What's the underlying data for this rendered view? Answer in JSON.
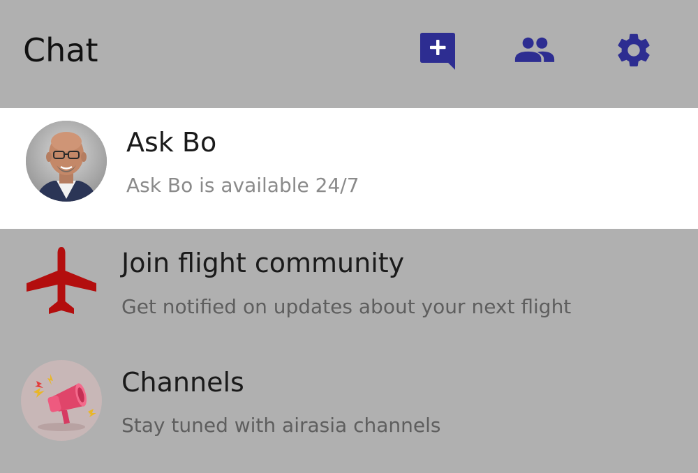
{
  "header": {
    "title": "Chat",
    "actions": [
      {
        "icon": "new-chat-icon"
      },
      {
        "icon": "group-icon"
      },
      {
        "icon": "gear-icon"
      }
    ]
  },
  "colors": {
    "background": "#b0b0b0",
    "highlight_row": "#ffffff",
    "accent_icon": "#2d2d91",
    "plane": "#b30e0e"
  },
  "chats": [
    {
      "title": "Ask Bo",
      "subtitle": "Ask Bo is available 24/7",
      "icon": "avatar"
    },
    {
      "title": "Join flight community",
      "subtitle": "Get notified on updates about your next flight",
      "icon": "airplane-icon"
    },
    {
      "title": "Channels",
      "subtitle": "Stay tuned with airasia channels",
      "icon": "megaphone-icon"
    }
  ]
}
